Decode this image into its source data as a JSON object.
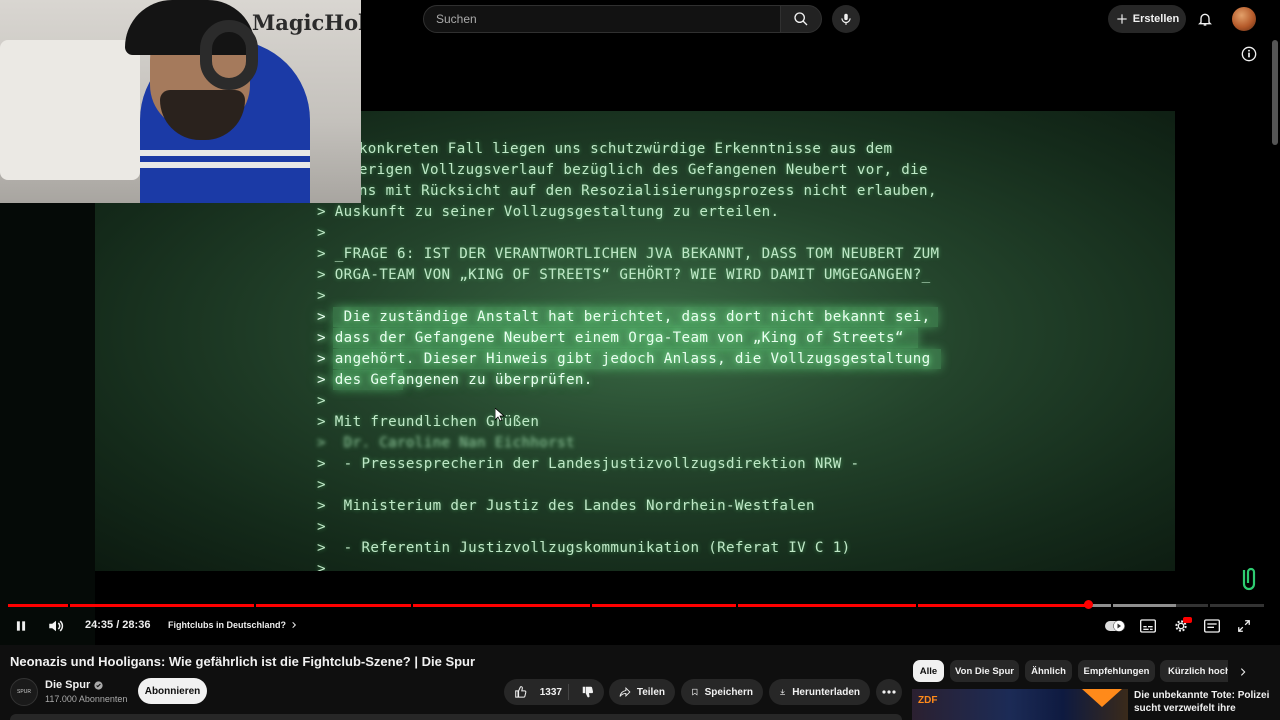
{
  "search": {
    "placeholder": "Suchen"
  },
  "header": {
    "create_label": "Erstellen"
  },
  "overlay": {
    "brand": "MagicHolz"
  },
  "document": {
    "lines": [
      " konkreten Fall liegen uns schutzwürdige Erkenntnisse aus dem",
      "herigen Vollzugsverlauf bezüglich des Gefangenen Neubert vor, die",
      "uns mit Rücksicht auf den Resozialisierungsprozess nicht erlauben,",
      "> Auskunft zu seiner Vollzugsgestaltung zu erteilen.",
      ">",
      "> _FRAGE 6: IST DER VERANTWORTLICHEN JVA BEKANNT, DASS TOM NEUBERT ZUM",
      "> ORGA-TEAM VON „KING OF STREETS“ GEHÖRT? WIE WIRD DAMIT UMGEGANGEN?_",
      ">",
      ">  Die zuständige Anstalt hat berichtet, dass dort nicht bekannt sei,",
      "> dass der Gefangene Neubert einem Orga-Team von „King of Streets“",
      "> angehört. Dieser Hinweis gibt jedoch Anlass, die Vollzugsgestaltung",
      "> des Gefangenen zu überprüfen.",
      ">",
      "> Mit freundlichen Grüßen",
      ">  Dr. Caroline Nan Eichhorst",
      ">  - Pressesprecherin der Landesjustizvollzugsdirektion NRW -",
      ">",
      ">  Ministerium der Justiz des Landes Nordrhein-Westfalen",
      ">",
      ">  - Referentin Justizvollzugskommunikation (Referat IV C 1)",
      ">"
    ]
  },
  "player": {
    "time": "24:35 / 28:36",
    "chapter": "Fightclubs in Deutschland?",
    "progress": 0.86
  },
  "video": {
    "title": "Neonazis und Hooligans: Wie gefährlich ist die Fightclub-Szene? | Die Spur",
    "channel": "Die Spur",
    "channel_avatar_text": "SPUR",
    "subscribers": "117.000 Abonnenten",
    "subscribe_label": "Abonnieren",
    "likes": "1337",
    "share_label": "Teilen",
    "save_label": "Speichern",
    "download_label": "Herunterladen"
  },
  "chips": [
    "Alle",
    "Von Die Spur",
    "Ähnlich",
    "Empfehlungen",
    "Kürzlich hochgeladen"
  ],
  "recommended": {
    "title": "Die unbekannte Tote: Polizei sucht verzweifelt ihre",
    "thumb_logo": "ZDF"
  },
  "colors": {
    "accent": "#ff0000",
    "background": "#0f0f0f",
    "screen_green": "#bfe8c7"
  }
}
